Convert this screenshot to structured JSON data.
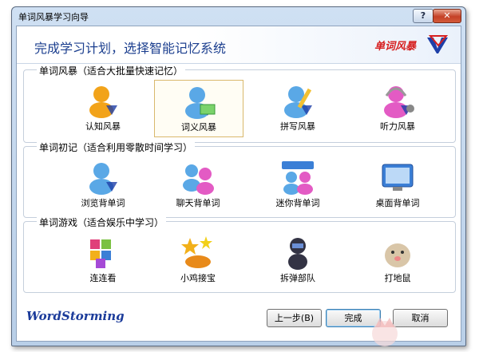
{
  "window": {
    "title": "单词风暴学习向导",
    "help_glyph": "?",
    "close_glyph": "✕"
  },
  "banner": {
    "title": "完成学习计划，选择智能记忆系统",
    "brand": "单词风暴"
  },
  "groups": [
    {
      "title": "单词风暴（适合大批量快速记忆）",
      "items": [
        {
          "label": "认知风暴",
          "icon": "user-bubble-icon",
          "color": "#f2a31a"
        },
        {
          "label": "词义风暴",
          "icon": "user-card-icon",
          "color": "#5aa8e6"
        },
        {
          "label": "拼写风暴",
          "icon": "user-pencil-icon",
          "color": "#5aa8e6"
        },
        {
          "label": "听力风暴",
          "icon": "user-headphones-icon",
          "color": "#e35bc4"
        }
      ]
    },
    {
      "title": "单词初记（适合利用零散时间学习）",
      "items": [
        {
          "label": "浏览背单词",
          "icon": "user-browse-icon",
          "color": "#5aa8e6"
        },
        {
          "label": "聊天背单词",
          "icon": "chat-users-icon",
          "color": "#e35bc4"
        },
        {
          "label": "迷你背单词",
          "icon": "mini-window-users-icon",
          "color": "#5aa8e6"
        },
        {
          "label": "桌面背单词",
          "icon": "desktop-icon",
          "color": "#3b7fd6"
        }
      ]
    },
    {
      "title": "单词游戏（适合娱乐中学习）",
      "items": [
        {
          "label": "连连看",
          "icon": "blocks-icon",
          "color": "#e0407a"
        },
        {
          "label": "小鸡接宝",
          "icon": "stars-basket-icon",
          "color": "#f2b01a"
        },
        {
          "label": "拆弹部队",
          "icon": "bomb-squad-icon",
          "color": "#333344"
        },
        {
          "label": "打地鼠",
          "icon": "mole-icon",
          "color": "#d9c6a8"
        }
      ]
    }
  ],
  "footer": {
    "logo": "WordStorming",
    "prev_label": "上一步(B)",
    "finish_label": "完成",
    "cancel_label": "取消"
  },
  "selected_item": "词义风暴"
}
